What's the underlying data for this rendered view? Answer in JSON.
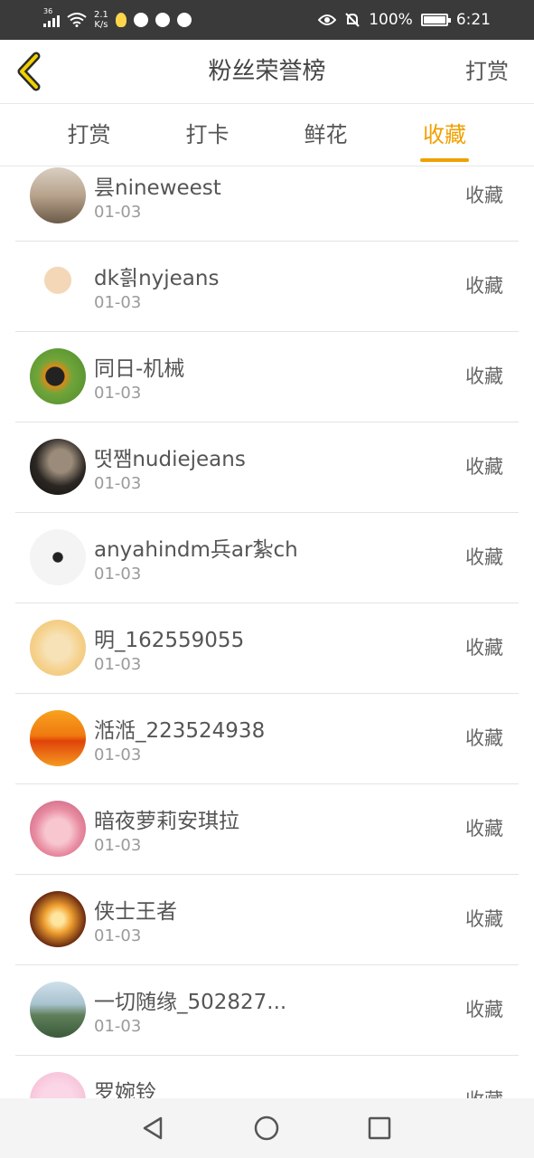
{
  "status_bar": {
    "signal": "36",
    "speed_value": "2.1",
    "speed_unit": "K/s",
    "battery": "100%",
    "time": "6:21"
  },
  "header": {
    "title": "粉丝荣誉榜",
    "action_label": "打赏"
  },
  "tabs": [
    {
      "label": "打赏",
      "active": false
    },
    {
      "label": "打卡",
      "active": false
    },
    {
      "label": "鲜花",
      "active": false
    },
    {
      "label": "收藏",
      "active": true
    }
  ],
  "list": [
    {
      "name": "昙nineweest",
      "date": "01-03",
      "action": "收藏"
    },
    {
      "name": "dk흵nyjeans",
      "date": "01-03",
      "action": "收藏"
    },
    {
      "name": "同日-机械",
      "date": "01-03",
      "action": "收藏"
    },
    {
      "name": "떳쨈nudiejeans",
      "date": "01-03",
      "action": "收藏"
    },
    {
      "name": "anyahindm兵ar紮ch",
      "date": "01-03",
      "action": "收藏"
    },
    {
      "name": "明_162559055",
      "date": "01-03",
      "action": "收藏"
    },
    {
      "name": "湉湉_223524938",
      "date": "01-03",
      "action": "收藏"
    },
    {
      "name": "暗夜萝莉安琪拉",
      "date": "01-03",
      "action": "收藏"
    },
    {
      "name": "侠士王者",
      "date": "01-03",
      "action": "收藏"
    },
    {
      "name": "一切随缘_502827...",
      "date": "01-03",
      "action": "收藏"
    },
    {
      "name": "罗婉铃",
      "date": "",
      "action": "收藏"
    }
  ],
  "colors": {
    "accent": "#f0a000",
    "status_bar": "#3a3a3a"
  }
}
